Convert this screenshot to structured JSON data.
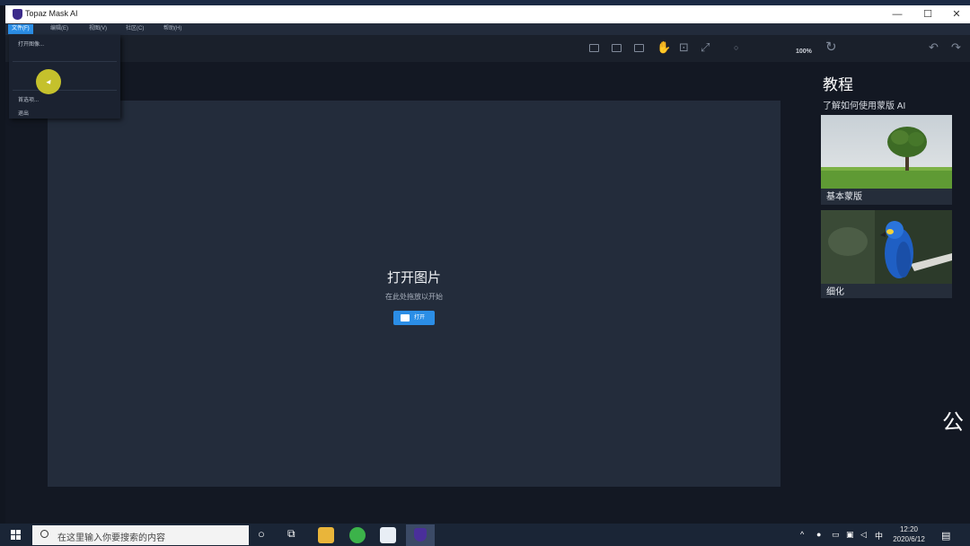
{
  "window": {
    "title": "Topaz Mask AI",
    "minimize": "—",
    "maximize": "☐",
    "close": "✕"
  },
  "menu": [
    {
      "label": "文件(F)",
      "active": true
    },
    {
      "label": "编辑(E)"
    },
    {
      "label": "视图(V)"
    },
    {
      "label": "社区(C)"
    },
    {
      "label": "帮助(H)"
    }
  ],
  "file_menu": {
    "open_image": "打开图像...",
    "preferences": "首选项...",
    "exit": "退出"
  },
  "toolbar": {
    "zoom": "100%"
  },
  "canvas": {
    "title": "打开图片",
    "subtitle": "在此处拖放以开始",
    "open_button": "打开"
  },
  "tutorials": {
    "title": "教程",
    "subtitle": "了解如何使用蒙版 AI",
    "cards": [
      {
        "label": "基本蒙版"
      },
      {
        "label": "细化"
      }
    ]
  },
  "side_glyph": "公",
  "taskbar": {
    "search_placeholder": "在这里输入你要搜索的内容",
    "ime": "中",
    "time": "12:20",
    "date": "2020/6/12"
  },
  "colors": {
    "accent": "#2b8ee6",
    "canvas": "#232c3b",
    "background": "#131823"
  }
}
